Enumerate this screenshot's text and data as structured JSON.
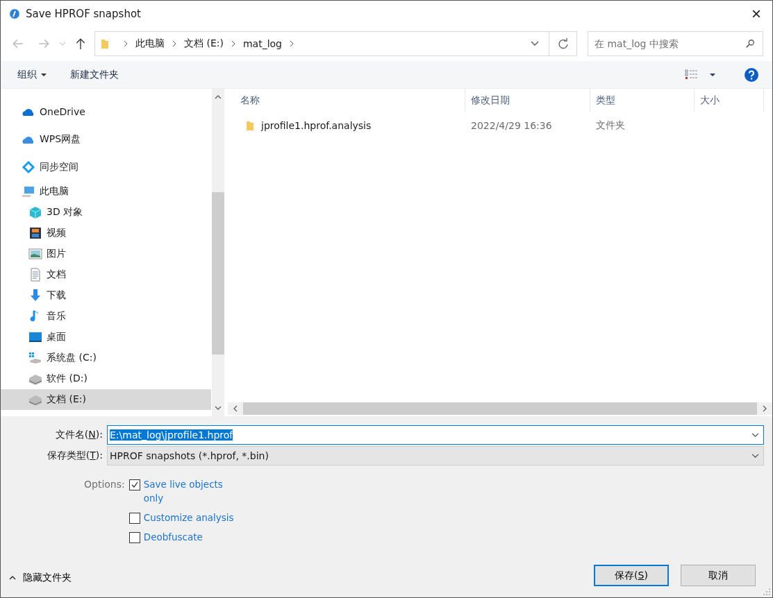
{
  "window": {
    "title": "Save HPROF snapshot",
    "close": "×"
  },
  "address": {
    "crumbs": [
      "此电脑",
      "文档 (E:)",
      "mat_log"
    ]
  },
  "search": {
    "placeholder": "在 mat_log 中搜索"
  },
  "toolbar": {
    "organize": "组织",
    "new_folder": "新建文件夹"
  },
  "sidebar": {
    "items": [
      {
        "label": "OneDrive",
        "kind": "onedrive",
        "selected": false
      },
      {
        "label": "WPS网盘",
        "kind": "cloud",
        "selected": false
      },
      {
        "label": "同步空间",
        "kind": "sync",
        "selected": false
      },
      {
        "label": "此电脑",
        "kind": "pc",
        "selected": false,
        "children": [
          {
            "label": "3D 对象",
            "kind": "cube",
            "selected": false
          },
          {
            "label": "视频",
            "kind": "video",
            "selected": false
          },
          {
            "label": "图片",
            "kind": "image",
            "selected": false
          },
          {
            "label": "文档",
            "kind": "doc",
            "selected": false
          },
          {
            "label": "下载",
            "kind": "download",
            "selected": false
          },
          {
            "label": "音乐",
            "kind": "music",
            "selected": false
          },
          {
            "label": "桌面",
            "kind": "desktop",
            "selected": false
          },
          {
            "label": "系统盘 (C:)",
            "kind": "sysdrive",
            "selected": false
          },
          {
            "label": "软件 (D:)",
            "kind": "drive",
            "selected": false
          },
          {
            "label": "文档 (E:)",
            "kind": "drive",
            "selected": true
          }
        ]
      }
    ]
  },
  "table": {
    "columns": [
      "名称",
      "修改日期",
      "类型",
      "大小"
    ],
    "rows": [
      {
        "name": "jprofile1.hprof.analysis",
        "date": "2022/4/29 16:36",
        "type": "文件夹"
      }
    ]
  },
  "filename": {
    "label_before": "文件名(",
    "label_key": "N",
    "label_after": "):",
    "value": "E:\\mat_log\\jprofile1.hprof"
  },
  "filetype": {
    "label_before": "保存类型(",
    "label_key": "T",
    "label_after": "):",
    "value": "HPROF snapshots (*.hprof, *.bin)"
  },
  "options": {
    "label": "Options:",
    "items": [
      {
        "label": "Save live objects only",
        "checked": true
      },
      {
        "label": "Customize analysis",
        "checked": false
      },
      {
        "label": "Deobfuscate",
        "checked": false
      }
    ]
  },
  "hide_folders": "隐藏文件夹",
  "buttons": [
    {
      "before": "保存(",
      "key": "S",
      "after": ")",
      "kind": "primary"
    },
    {
      "before": "取消",
      "kind": "normal"
    }
  ]
}
